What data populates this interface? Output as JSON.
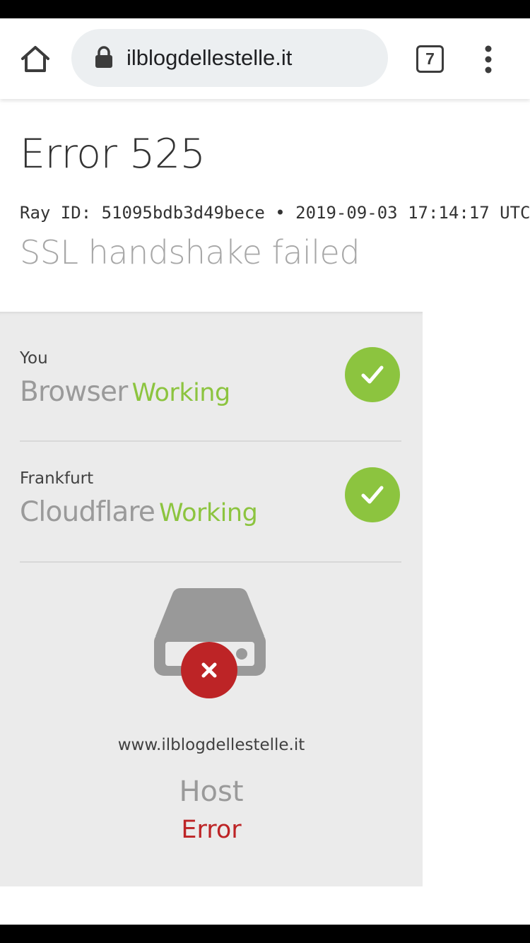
{
  "browser": {
    "url": "ilblogdellestelle.it",
    "tab_count": "7",
    "icons": [
      "home-icon",
      "lock-icon",
      "tab-switcher-icon",
      "more-vert-icon"
    ]
  },
  "page": {
    "title": "Error 525",
    "ray_line": "Ray ID: 51095bdb3d49bece • 2019-09-03 17:14:17 UTC",
    "subtitle": "SSL handshake failed"
  },
  "nodes": [
    {
      "location": "You",
      "name": "Browser",
      "status": "Working",
      "icon": "check-icon"
    },
    {
      "location": "Frankfurt",
      "name": "Cloudflare",
      "status": "Working",
      "icon": "check-icon"
    }
  ],
  "host": {
    "domain": "www.ilblogdellestelle.it",
    "name": "Host",
    "status": "Error",
    "icon": "server-error-icon"
  },
  "colors": {
    "working": "#8cc43f",
    "error": "#bd2426",
    "panel_bg": "#ebebeb"
  }
}
